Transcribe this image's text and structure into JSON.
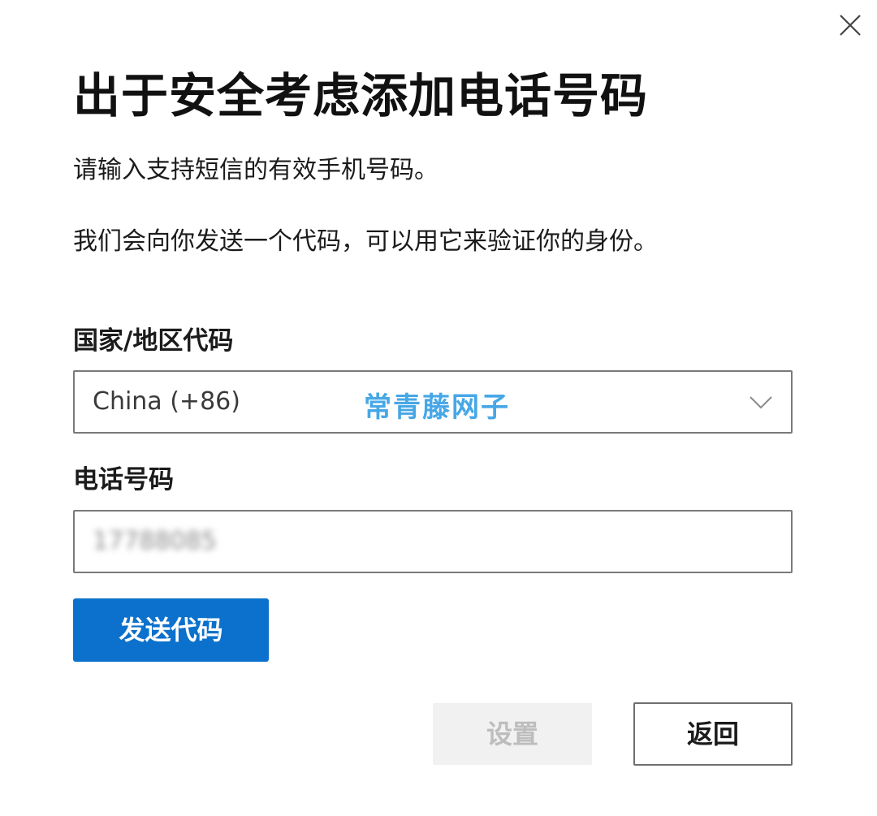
{
  "dialog": {
    "title": "出于安全考虑添加电话号码",
    "description_1": "请输入支持短信的有效手机号码。",
    "description_2": "我们会向你发送一个代码，可以用它来验证你的身份。"
  },
  "country_field": {
    "label": "国家/地区代码",
    "selected_value": "China (+86)",
    "watermark": "常青藤网子"
  },
  "phone_field": {
    "label": "电话号码",
    "value": "17788085"
  },
  "buttons": {
    "send_code": "发送代码",
    "set": "设置",
    "back": "返回"
  },
  "icons": {
    "close": "close-icon",
    "dropdown": "chevron-down-icon"
  },
  "colors": {
    "primary": "#0b71cc",
    "watermark": "#47a7e6",
    "disabled_bg": "#f1f1f1",
    "disabled_text": "#bdbdbd"
  }
}
